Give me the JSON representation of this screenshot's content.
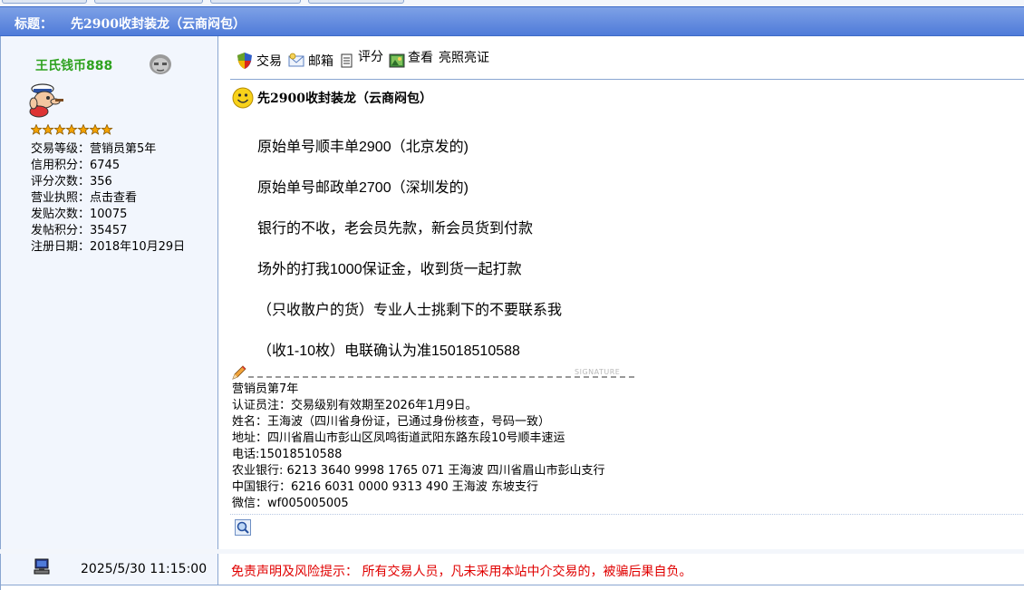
{
  "thread": {
    "title_label": "标题：",
    "title": "先2900收封装龙（云商闷包）"
  },
  "author": {
    "name": "王氏钱币888",
    "stats": [
      "交易等级：营销员第5年",
      "信用积分：6745",
      "评分次数：356",
      "营业执照：点击查看",
      "发贴次数：10075",
      "发帖积分：35457",
      "注册日期：2018年10月29日"
    ]
  },
  "toolbar": {
    "trade": "交易",
    "mail": "邮箱",
    "rate": "评分",
    "view": "查看",
    "license": "亮照亮证"
  },
  "post": {
    "title": "先2900收封装龙（云商闷包）",
    "lines": [
      "原始单号顺丰单2900（北京发的)",
      "原始单号邮政单2700（深圳发的)",
      "银行的不收，老会员先款，新会员货到付款",
      "场外的打我1000保证金，收到货一起打款",
      " （只收散户的货）专业人士挑剩下的不要联系我",
      " （收1-10枚）电联确认为准15018510588"
    ],
    "signature_badge": "SIGNATURE",
    "signature_lines": [
      "营销员第7年",
      "认证员注：交易级别有效期至2026年1月9日。",
      "姓名：王海波（四川省身份证，已通过身份核查，号码一致）",
      "地址：四川省眉山市彭山区凤鸣街道武阳东路东段10号顺丰速运",
      "电话:15018510588",
      "农业银行: 6213 3640 9998 1765 071  王海波  四川省眉山市彭山支行",
      "中国银行：6216 6031 0000 9313 490  王海波  东坡支行",
      "微信：wf005005005"
    ]
  },
  "footer": {
    "time": "2025/5/30 11:15:00",
    "disclaimer": "免责声明及风险提示： 所有交易人员，凡未采用本站中介交易的，被骗后果自负。"
  },
  "colors": {
    "title_bar": "#5a83da",
    "username": "#2fa21f",
    "disclaimer": "#e00000",
    "border": "#8aa6d1"
  }
}
